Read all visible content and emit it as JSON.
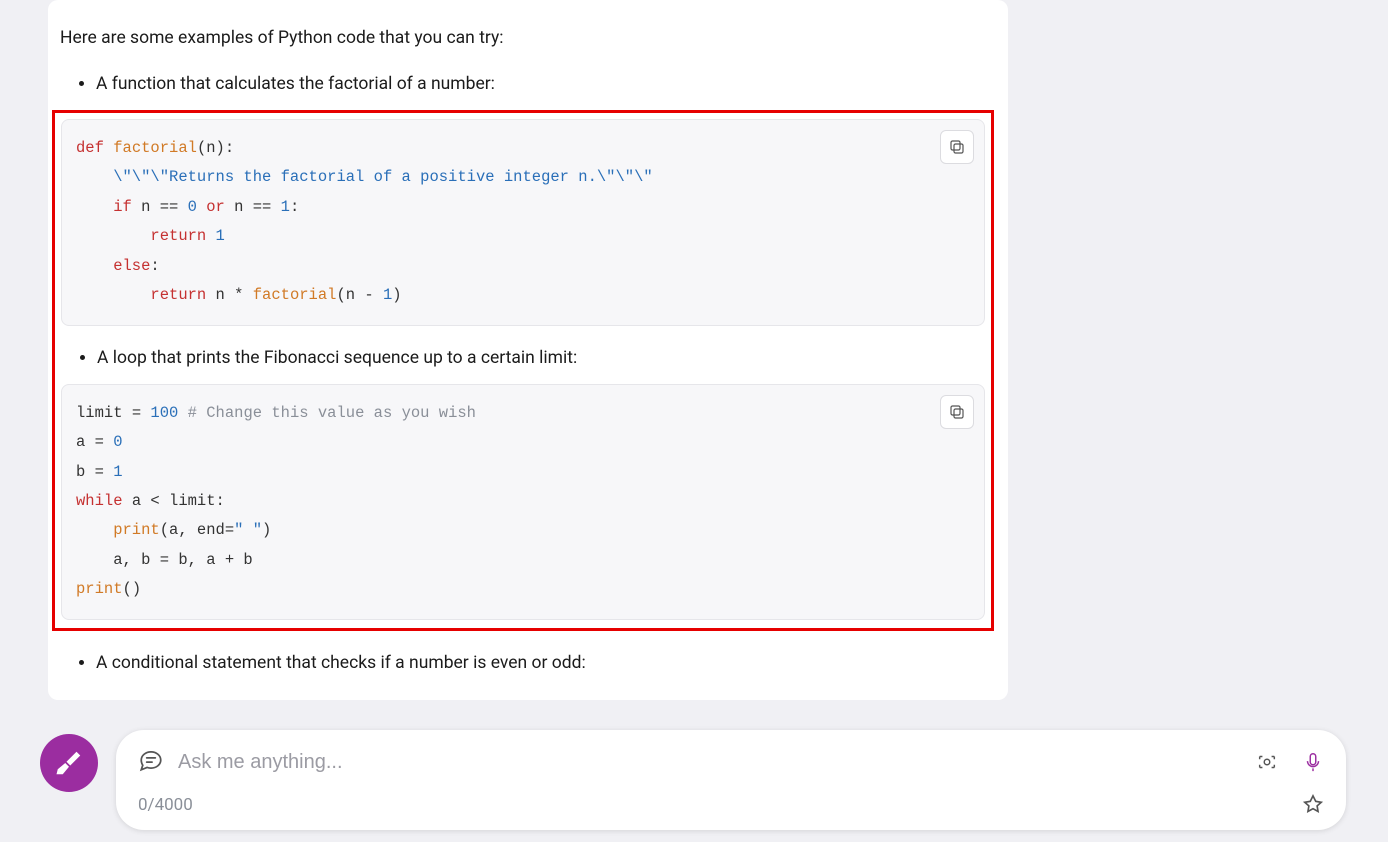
{
  "message": {
    "intro": "Here are some examples of Python code that you can try:",
    "bullet1": "A function that calculates the factorial of a number:",
    "bullet2": "A loop that prints the Fibonacci sequence up to a certain limit:",
    "bullet3": "A conditional statement that checks if a number is even or odd:"
  },
  "code": {
    "factorial": {
      "l1_def": "def",
      "l1_fn": "factorial",
      "l1_rest": "(n):",
      "l2": "    \\\"\\\"\\\"Returns the factorial of a positive integer n.\\\"\\\"\\\"",
      "l3_if": "    if",
      "l3_mid": " n == ",
      "l3_zero": "0",
      "l3_or": " or ",
      "l3_n2": "n == ",
      "l3_one": "1",
      "l3_colon": ":",
      "l4_ret": "        return ",
      "l4_one": "1",
      "l5_else": "    else",
      "l5_colon": ":",
      "l6_ret": "        return ",
      "l6_rest1": "n * ",
      "l6_fn": "factorial",
      "l6_rest2": "(n - ",
      "l6_one": "1",
      "l6_rest3": ")"
    },
    "fib": {
      "l1_var": "limit",
      "l1_eq": " = ",
      "l1_num": "100",
      "l1_sp": " ",
      "l1_cmt": "# Change this value as you wish",
      "l2_var": "a = ",
      "l2_num": "0",
      "l3_var": "b = ",
      "l3_num": "1",
      "l4_while": "while",
      "l4_rest": " a < limit:",
      "l5_print": "    print",
      "l5_args": "(a, end=",
      "l5_str": "\" \"",
      "l5_close": ")",
      "l6": "    a, b = b, a + b",
      "l7_print": "print",
      "l7_args": "()"
    }
  },
  "input": {
    "placeholder": "Ask me anything...",
    "counter": "0/4000"
  }
}
